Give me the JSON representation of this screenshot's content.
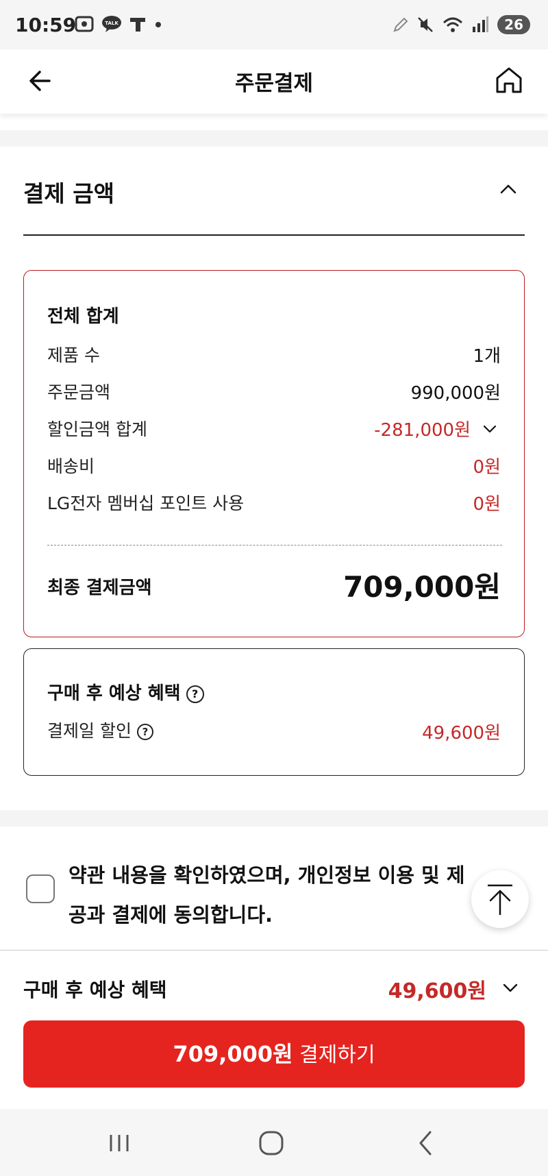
{
  "status_bar": {
    "time": "10:59",
    "battery": "26",
    "left_icons": [
      "screenshot-icon",
      "talk-icon",
      "t-icon",
      "dot-icon"
    ],
    "right_icons": [
      "pencil-icon",
      "mute-icon",
      "wifi-icon",
      "signal-icon",
      "battery-icon"
    ]
  },
  "header": {
    "title": "주문결제",
    "back_icon": "back-arrow-icon",
    "home_icon": "home-icon"
  },
  "payment_section": {
    "title": "결제 금액",
    "collapse_icon": "chevron-up-icon",
    "total_box": {
      "heading": "전체 합계",
      "rows": [
        {
          "label": "제품 수",
          "value": "1개",
          "highlight": false
        },
        {
          "label": "주문금액",
          "value": "990,000원",
          "highlight": false
        },
        {
          "label": "할인금액 합계",
          "value": "-281,000원",
          "highlight": true,
          "expandable": true
        },
        {
          "label": "배송비",
          "value": "0원",
          "highlight": true
        },
        {
          "label": "LG전자 멤버십 포인트 사용",
          "value": "0원",
          "highlight": true
        }
      ],
      "final_label": "최종 결제금액",
      "final_value": "709,000원"
    },
    "benefit_box": {
      "heading": "구매 후 예상 혜택",
      "help_icon": "question-icon",
      "row_label": "결제일 할인",
      "row_value": "49,600원"
    }
  },
  "agreement": {
    "text": "약관 내용을 확인하였으며, 개인정보 이용 및 제공과 결제에 동의합니다.",
    "checked": false
  },
  "scroll_top_icon": "arrow-up-icon",
  "bottom_panel": {
    "label": "구매 후 예상 혜택",
    "value": "49,600원",
    "pay_amount": "709,000원",
    "pay_label": "결제하기"
  },
  "nav_bar": {
    "icons": [
      "recent-apps-icon",
      "home-circle-icon",
      "back-chevron-icon"
    ]
  },
  "colors": {
    "accent_red": "#e5241f",
    "text_red": "#c62828",
    "box_border_red": "#b71c1c"
  }
}
